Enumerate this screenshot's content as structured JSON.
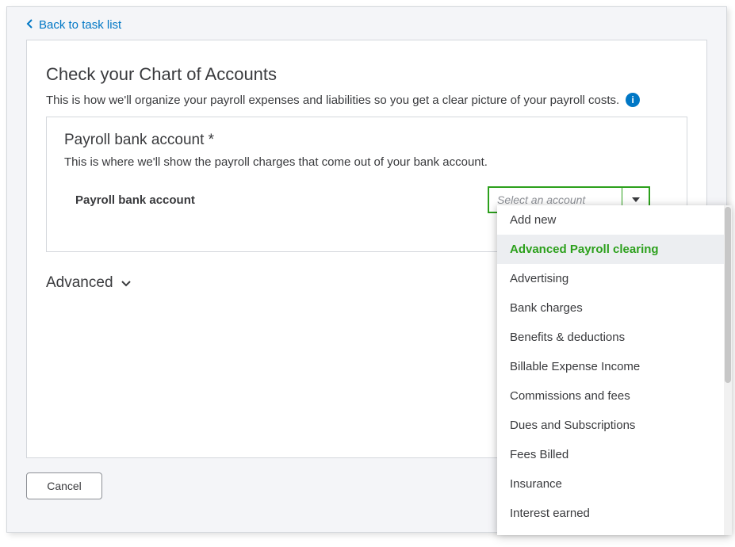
{
  "back_link": "Back to task list",
  "page": {
    "title": "Check your Chart of Accounts",
    "subtitle": "This is how we'll organize your payroll expenses and liabilities so you get a clear picture of your payroll costs."
  },
  "section": {
    "title": "Payroll bank account *",
    "desc": "This is where we'll show the payroll charges that come out of your bank account.",
    "field_label": "Payroll bank account",
    "select_placeholder": "Select an account"
  },
  "advanced_label": "Advanced",
  "cancel_label": "Cancel",
  "dropdown": {
    "items": [
      "Add new",
      "Advanced Payroll clearing",
      "Advertising",
      "Bank charges",
      "Benefits & deductions",
      "Billable Expense Income",
      "Commissions and fees",
      "Dues and Subscriptions",
      "Fees Billed",
      "Insurance",
      "Interest earned"
    ],
    "highlighted_index": 1
  }
}
